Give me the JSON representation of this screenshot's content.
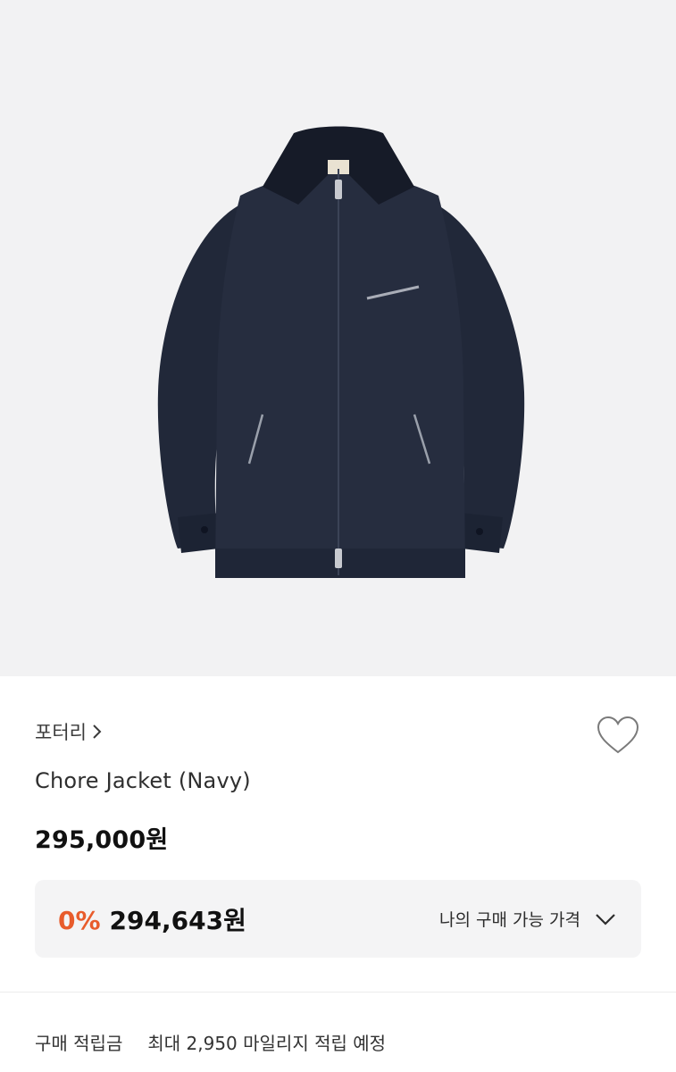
{
  "product": {
    "brand": "포터리",
    "name": "Chore Jacket (Navy)",
    "price": "295,000원",
    "image_icon": "navy-chore-jacket-image"
  },
  "benefit": {
    "discount": "0%",
    "final_price": "294,643원",
    "label": "나의 구매 가능 가격"
  },
  "points": {
    "label": "구매 적립금",
    "value": "최대 2,950 마일리지 적립 예정"
  },
  "colors": {
    "discount": "#e85c2c",
    "jacket": "#252c3d",
    "background_image": "#f2f2f3"
  },
  "icons": {
    "brand_chevron": "chevron-right-icon",
    "wish": "heart-outline-icon",
    "benefit_toggle": "chevron-down-icon"
  }
}
